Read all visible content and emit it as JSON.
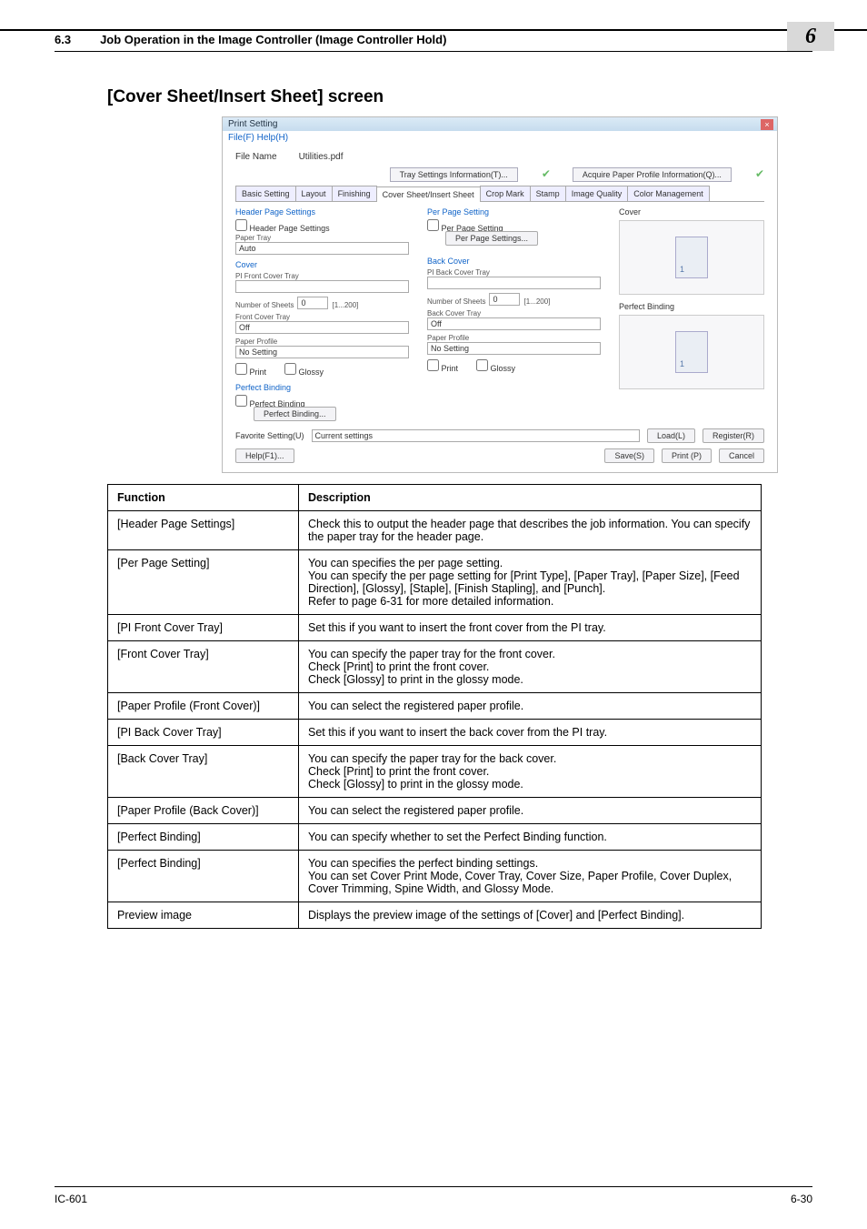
{
  "header": {
    "section": "6.3",
    "title": "Job Operation in the Image Controller (Image Controller Hold)",
    "chapter": "6"
  },
  "heading": "[Cover Sheet/Insert Sheet] screen",
  "dialog": {
    "title": "Print Setting",
    "menu": "File(F)   Help(H)",
    "file_label": "File Name",
    "file_name": "Utilities.pdf",
    "tray_btn": "Tray Settings Information(T)...",
    "paper_btn": "Acquire Paper Profile Information(Q)...",
    "tabs": [
      "Basic Setting",
      "Layout",
      "Finishing",
      "Cover Sheet/Insert Sheet",
      "Crop Mark",
      "Stamp",
      "Image Quality",
      "Color Management"
    ],
    "left": {
      "hps": "Header Page Settings",
      "hps_cb": "Header Page Settings",
      "paper_tray_lbl": "Paper Tray",
      "paper_tray_val": "Auto",
      "cover": "Cover",
      "pi_front": "PI Front Cover Tray",
      "num_sheets": "Number of Sheets",
      "num_val": "0",
      "num_range": "[1...200]",
      "front_tray_lbl": "Front Cover Tray",
      "front_tray_val": "Off",
      "pp_lbl": "Paper Profile",
      "pp_val": "No Setting",
      "print_cb": "Print",
      "glossy_cb": "Glossy",
      "pb": "Perfect Binding",
      "pb_cb": "Perfect Binding",
      "pb_btn": "Perfect Binding..."
    },
    "mid": {
      "pps": "Per Page Setting",
      "pps_cb": "Per Page Setting",
      "pps_btn": "Per Page Settings...",
      "back": "Back Cover",
      "pi_back": "PI Back Cover Tray",
      "num_sheets": "Number of Sheets",
      "num_val": "0",
      "num_range": "[1...200]",
      "back_tray_lbl": "Back Cover Tray",
      "back_tray_val": "Off",
      "pp_lbl": "Paper Profile",
      "pp_val": "No Setting",
      "print_cb": "Print",
      "glossy_cb": "Glossy"
    },
    "preview": {
      "cover": "Cover",
      "pb": "Perfect Binding"
    },
    "fav_lbl": "Favorite Setting(U)",
    "fav_val": "Current settings",
    "load": "Load(L)",
    "register": "Register(R)",
    "help": "Help(F1)...",
    "save": "Save(S)",
    "print": "Print (P)",
    "cancel": "Cancel"
  },
  "table": {
    "h1": "Function",
    "h2": "Description",
    "rows": [
      {
        "fn": "[Header Page Settings]",
        "desc": "Check this to output the header page that describes the job information. You can specify the paper tray for the header page."
      },
      {
        "fn": "[Per Page Setting]",
        "desc": "You can specifies the per page setting.\nYou can specify the per page setting for [Print Type], [Paper Tray], [Paper Size], [Feed Direction], [Glossy], [Staple], [Finish Stapling], and [Punch].\nRefer to page 6-31 for more detailed information."
      },
      {
        "fn": "[PI Front Cover Tray]",
        "desc": "Set this if you want to insert the front cover from the PI tray."
      },
      {
        "fn": "[Front Cover Tray]",
        "desc": "You can specify the paper tray for the front cover.\nCheck [Print] to print the front cover.\nCheck [Glossy] to print in the glossy mode."
      },
      {
        "fn": "[Paper Profile (Front Cover)]",
        "desc": "You can select the registered paper profile."
      },
      {
        "fn": "[PI Back Cover Tray]",
        "desc": "Set this if you want to insert the back cover from the PI tray."
      },
      {
        "fn": "[Back Cover Tray]",
        "desc": "You can specify the paper tray for the back cover.\nCheck [Print] to print the front cover.\nCheck [Glossy] to print in the glossy mode."
      },
      {
        "fn": "[Paper Profile (Back Cover)]",
        "desc": "You can select the registered paper profile."
      },
      {
        "fn": "[Perfect Binding]",
        "desc": "You can specify whether to set the Perfect Binding function."
      },
      {
        "fn": "[Perfect Binding]",
        "desc": "You can specifies the perfect binding settings.\nYou can set Cover Print Mode, Cover Tray, Cover Size, Paper Profile, Cover Duplex, Cover Trimming, Spine Width, and Glossy Mode."
      },
      {
        "fn": "Preview image",
        "desc": "Displays the preview image of the settings of [Cover] and [Perfect Binding]."
      }
    ]
  },
  "footer": {
    "left": "IC-601",
    "right": "6-30"
  }
}
